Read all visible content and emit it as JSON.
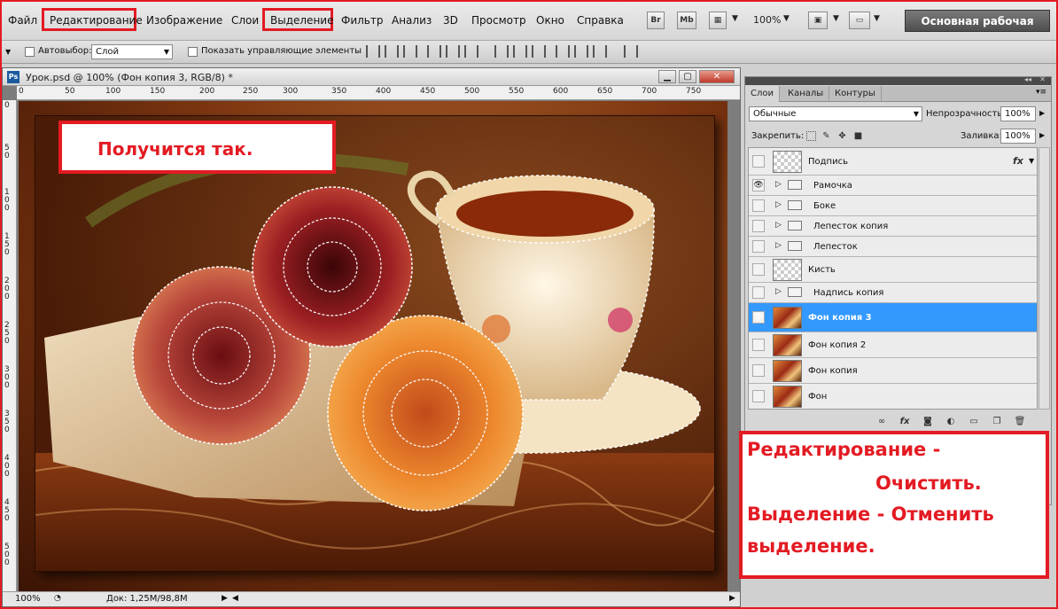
{
  "menu": {
    "items": [
      "Файл",
      "Редактирование",
      "Изображение",
      "Слои",
      "Выделение",
      "Фильтр",
      "Анализ",
      "3D",
      "Просмотр",
      "Окно",
      "Справка"
    ],
    "br_label": "Br",
    "mb_label": "Mb",
    "zoom": "100%",
    "workspace": "Основная рабочая среда"
  },
  "options": {
    "autoselect_label": "Автовыбор:",
    "autoselect_value": "Слой",
    "show_controls_label": "Показать управляющие элементы"
  },
  "document": {
    "title": "Урок.psd @ 100% (Фон  копия 3, RGB/8) *",
    "ps_label": "Ps",
    "ruler_top": [
      "0",
      "50",
      "100",
      "150",
      "200",
      "250",
      "300",
      "350",
      "400",
      "450",
      "500",
      "550",
      "600",
      "650",
      "700",
      "750"
    ],
    "ruler_left": [
      "0",
      "50",
      "100",
      "150",
      "200",
      "250",
      "300",
      "350",
      "400",
      "450",
      "500"
    ],
    "status_zoom": "100%",
    "status_doc": "Док: 1,25M/98,8M"
  },
  "callouts": {
    "top_text": "Получится так.",
    "right_line1": "Редактирование -",
    "right_line2": "Очистить.",
    "right_line3": "Выделение - Отменить",
    "right_line4": "выделение."
  },
  "panel": {
    "tabs": [
      "Слои",
      "Каналы",
      "Контуры"
    ],
    "blend_mode": "Обычные",
    "opacity_label": "Непрозрачность:",
    "opacity_value": "100%",
    "lock_label": "Закрепить:",
    "fill_label": "Заливка:",
    "fill_value": "100%",
    "layers": [
      {
        "name": "Подпись",
        "kind": "empty",
        "visible": false,
        "fx": "fx"
      },
      {
        "name": "Рамочка",
        "kind": "group",
        "visible": true
      },
      {
        "name": "Боке",
        "kind": "group",
        "visible": false
      },
      {
        "name": "Лепесток копия",
        "kind": "group",
        "visible": false
      },
      {
        "name": "Лепесток",
        "kind": "group",
        "visible": false
      },
      {
        "name": "Кисть",
        "kind": "empty",
        "visible": false
      },
      {
        "name": "Надпись копия",
        "kind": "group",
        "visible": false
      },
      {
        "name": "Фон  копия 3",
        "kind": "image",
        "visible": true,
        "selected": true
      },
      {
        "name": "Фон  копия 2",
        "kind": "image",
        "visible": false
      },
      {
        "name": "Фон  копия",
        "kind": "image",
        "visible": false
      },
      {
        "name": "Фон",
        "kind": "image",
        "visible": false
      }
    ]
  },
  "colors": {
    "accent": "#e31b23",
    "selection": "#3399ff",
    "workspace_btn": "#5a5a5a"
  }
}
